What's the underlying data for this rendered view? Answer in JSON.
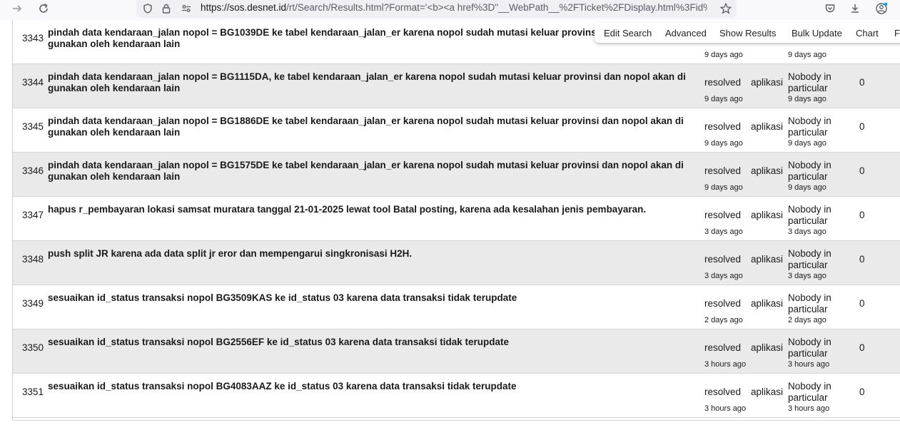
{
  "browser": {
    "url_host": "https://sos.desnet.id",
    "url_path": "/rt/Search/Results.html?Format='<b><a href%3D\"__WebPath__%2FTicket%2FDisplay.html%3Fid%"
  },
  "page_menu": {
    "items": [
      "Edit Search",
      "Advanced",
      "Show Results",
      "Bulk Update",
      "Chart",
      "F"
    ]
  },
  "tickets": [
    {
      "id": "3343",
      "subject_line1": "pindah data kendaraan_jalan nopol = BG1039DE ke tabel kendaraan_jalan_er karena nopol sudah mutasi keluar provinsi",
      "subject_line2": "gunakan oleh kendaraan lain",
      "status": "",
      "queue": "",
      "owner_line1": "",
      "owner_line2": "particular",
      "priority": "",
      "told": "9 days ago",
      "last_updated": "9 days ago"
    },
    {
      "id": "3344",
      "subject_line1": "pindah data kendaraan_jalan nopol = BG1115DA, ke tabel kendaraan_jalan_er karena nopol sudah mutasi keluar provinsi dan nopol akan di",
      "subject_line2": "gunakan oleh kendaraan lain",
      "status": "resolved",
      "queue": "aplikasi",
      "owner_line1": "Nobody in",
      "owner_line2": "particular",
      "priority": "0",
      "told": "9 days ago",
      "last_updated": "9 days ago"
    },
    {
      "id": "3345",
      "subject_line1": "pindah data kendaraan_jalan nopol = BG1886DE ke tabel kendaraan_jalan_er karena nopol sudah mutasi keluar provinsi dan nopol akan di",
      "subject_line2": "gunakan oleh kendaraan lain",
      "status": "resolved",
      "queue": "aplikasi",
      "owner_line1": "Nobody in",
      "owner_line2": "particular",
      "priority": "0",
      "told": "9 days ago",
      "last_updated": "9 days ago"
    },
    {
      "id": "3346",
      "subject_line1": "pindah data kendaraan_jalan nopol = BG1575DE ke tabel kendaraan_jalan_er karena nopol sudah mutasi keluar provinsi dan nopol akan di",
      "subject_line2": "gunakan oleh kendaraan lain",
      "status": "resolved",
      "queue": "aplikasi",
      "owner_line1": "Nobody in",
      "owner_line2": "particular",
      "priority": "0",
      "told": "9 days ago",
      "last_updated": "9 days ago"
    },
    {
      "id": "3347",
      "subject_line1": "hapus r_pembayaran lokasi samsat muratara tanggal 21-01-2025 lewat tool Batal posting, karena ada kesalahan jenis pembayaran.",
      "subject_line2": "",
      "status": "resolved",
      "queue": "aplikasi",
      "owner_line1": "Nobody in",
      "owner_line2": "particular",
      "priority": "0",
      "told": "3 days ago",
      "last_updated": "3 days ago"
    },
    {
      "id": "3348",
      "subject_line1": "push split JR karena ada data split jr eror dan mempengarui singkronisasi H2H.",
      "subject_line2": "",
      "status": "resolved",
      "queue": "aplikasi",
      "owner_line1": "Nobody in",
      "owner_line2": "particular",
      "priority": "0",
      "told": "3 days ago",
      "last_updated": "3 days ago"
    },
    {
      "id": "3349",
      "subject_line1": "sesuaikan id_status transaksi nopol BG3509KAS ke id_status 03 karena data transaksi tidak terupdate",
      "subject_line2": "",
      "status": "resolved",
      "queue": "aplikasi",
      "owner_line1": "Nobody in",
      "owner_line2": "particular",
      "priority": "0",
      "told": "2 days ago",
      "last_updated": "2 days ago"
    },
    {
      "id": "3350",
      "subject_line1": "sesuaikan id_status transaksi nopol BG2556EF ke id_status 03 karena data transaksi tidak terupdate",
      "subject_line2": "",
      "status": "resolved",
      "queue": "aplikasi",
      "owner_line1": "Nobody in",
      "owner_line2": "particular",
      "priority": "0",
      "told": "3 hours ago",
      "last_updated": "3 hours ago"
    },
    {
      "id": "3351",
      "subject_line1": "sesuaikan id_status transaksi nopol BG4083AAZ ke id_status 03 karena data transaksi tidak terupdate",
      "subject_line2": "",
      "status": "resolved",
      "queue": "aplikasi",
      "owner_line1": "Nobody in",
      "owner_line2": "particular",
      "priority": "0",
      "told": "3 hours ago",
      "last_updated": "3 hours ago"
    }
  ]
}
